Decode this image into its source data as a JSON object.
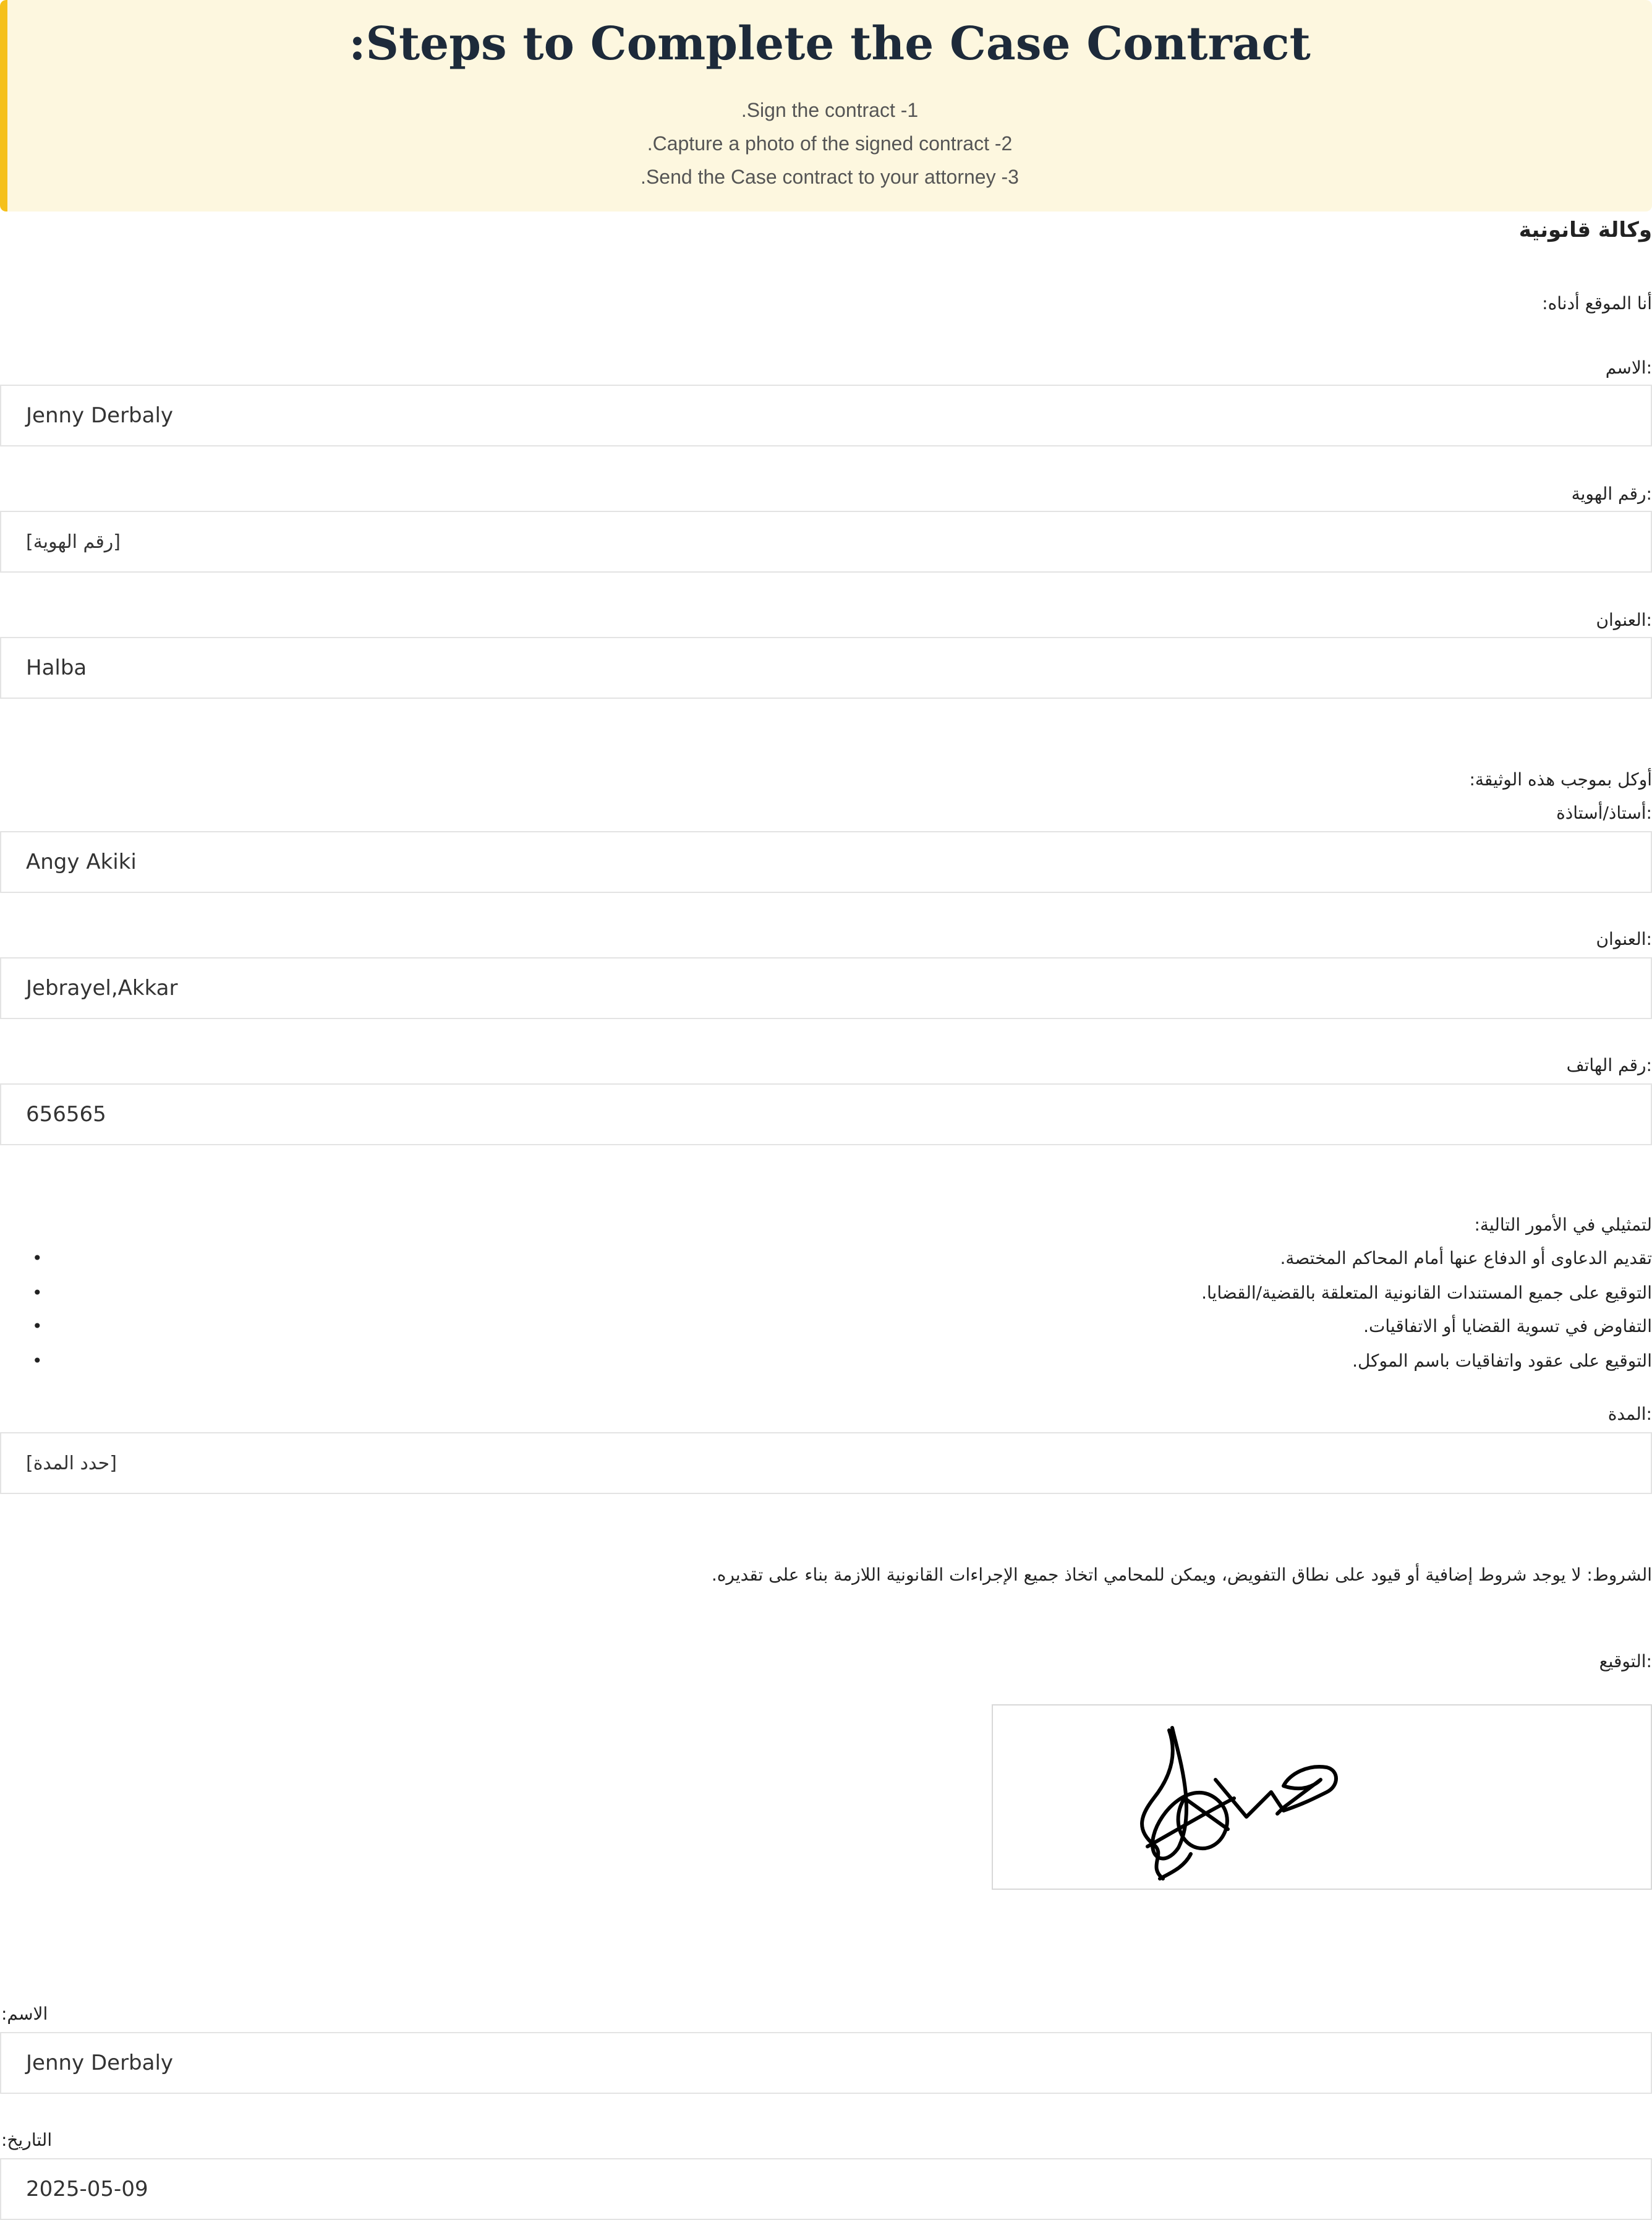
{
  "banner": {
    "title": ":Steps to Complete the Case Contract",
    "steps": [
      ".Sign the contract -1",
      ".Capture a photo of the signed contract -2",
      ".Send the Case contract to your attorney -3"
    ],
    "accent_color": "#f5c01a",
    "background_color": "#fdf7df"
  },
  "document": {
    "title": "وكالة قانونية",
    "intro": "أنا الموقع أدناه:",
    "principal": {
      "name_label": ":الاسم",
      "name_value": "Jenny Derbaly",
      "id_label": ":رقم الهوية",
      "id_value": "[رقم الهوية]",
      "address_label": ":العنوان",
      "address_value": "Halba"
    },
    "appoint_text": "أوكل بموجب هذه الوثيقة:",
    "attorney": {
      "title_label": ":أستاذ/أستاذة",
      "name_value": "Angy Akiki",
      "address_label": ":العنوان",
      "address_value": "Jebrayel,Akkar",
      "phone_label": ":رقم الهاتف",
      "phone_value": "656565"
    },
    "represent_text": "لتمثيلي في الأمور التالية:",
    "powers": [
      "تقديم الدعاوى أو الدفاع عنها أمام المحاكم المختصة.",
      "التوقيع على جميع المستندات القانونية المتعلقة بالقضية/القضايا.",
      "التفاوض في تسوية القضايا أو الاتفاقيات.",
      "التوقيع على عقود واتفاقيات باسم الموكل."
    ],
    "duration_label": ":المدة",
    "duration_value": "[حدد المدة]",
    "conditions": "الشروط: لا يوجد شروط إضافية أو قيود على نطاق التفويض، ويمكن للمحامي اتخاذ جميع الإجراءات القانونية اللازمة بناء على تقديره.",
    "signature_label": ":التوقيع",
    "footer": {
      "name_label": "الاسم:",
      "name_value": "Jenny Derbaly",
      "date_label": "التاريخ:",
      "date_value": "2025-05-09"
    }
  }
}
